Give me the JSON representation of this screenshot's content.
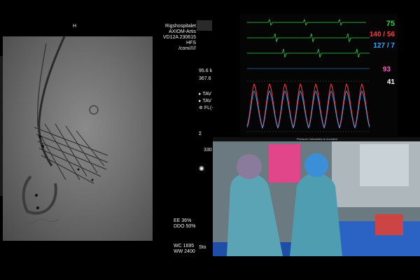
{
  "fluoro_header": {
    "orientation_marker": "H"
  },
  "site_info": {
    "hospital": "Rigshospitalet",
    "system": "AXIOM-Artis",
    "version": "VD12A 230615",
    "position": "HFS",
    "path": "/com/////"
  },
  "exposure": {
    "kv": "95.6 k",
    "ma": "367.6"
  },
  "labels": {
    "tav_1": "TAV",
    "tav_2": "TAV",
    "fl": "FL(-"
  },
  "sigma_symbol": "Σ",
  "sigma_value": "330",
  "stopwatch_label": "Sto",
  "image_stats": {
    "ee": "EE 36%",
    "ddo": "DDO 50%",
    "wc": "WC 1695",
    "ww": "WW 2400"
  },
  "vitals": {
    "hr": {
      "value": "75",
      "color": "#2fd14a"
    },
    "art": {
      "value": "140 / 56",
      "color": "#ff3b3b"
    },
    "pa": {
      "value": "127 / 7",
      "color": "#3aa7ff"
    },
    "spo2": {
      "value": "93",
      "color": "#ff5cc8"
    },
    "resp": {
      "value": "41",
      "color": "#ffffff"
    }
  },
  "video": {
    "caption": "Pressure Calculation is recorded"
  }
}
